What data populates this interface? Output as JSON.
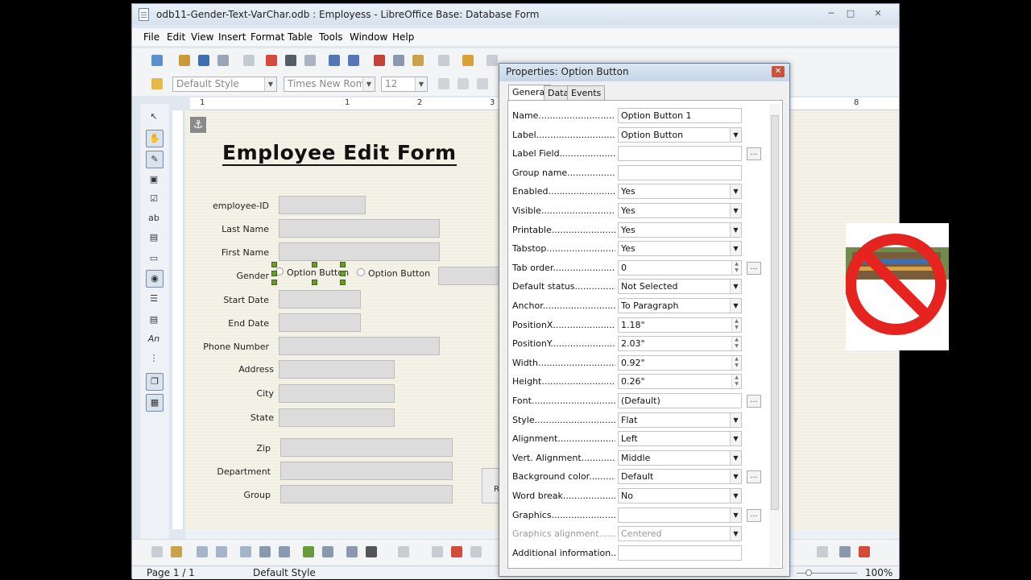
{
  "window": {
    "title": "odb11-Gender-Text-VarChar.odb : Employess - LibreOffice Base: Database Form"
  },
  "menu": [
    "File",
    "Edit",
    "View",
    "Insert",
    "Format",
    "Table",
    "Tools",
    "Window",
    "Help"
  ],
  "format_toolbar": {
    "style": "Default Style",
    "font": "Times New Roman",
    "size": "12"
  },
  "ruler_numbers": [
    "1",
    "1",
    "2",
    "3",
    "8"
  ],
  "form": {
    "title": "Employee Edit Form",
    "labels": {
      "employee_id": "employee-ID",
      "last_name": "Last Name",
      "first_name": "First Name",
      "gender": "Gender",
      "start_date": "Start Date",
      "end_date": "End Date",
      "phone": "Phone Number",
      "address": "Address",
      "city": "City",
      "state": "State",
      "zip": "Zip",
      "department": "Department",
      "group": "Group"
    },
    "radio1": "Option Button",
    "radio2": "Option Button",
    "hidden_button_letter": "R"
  },
  "properties": {
    "title": "Properties: Option Button",
    "tabs": [
      "General",
      "Data",
      "Events"
    ],
    "rows": [
      {
        "label": "Name",
        "value": "Option Button 1",
        "kind": "text"
      },
      {
        "label": "Label",
        "value": "Option Button",
        "kind": "drop"
      },
      {
        "label": "Label Field",
        "value": "",
        "kind": "text",
        "dots": true
      },
      {
        "label": "Group name",
        "value": "",
        "kind": "text"
      },
      {
        "label": "Enabled",
        "value": "Yes",
        "kind": "drop"
      },
      {
        "label": "Visible",
        "value": "Yes",
        "kind": "drop"
      },
      {
        "label": "Printable",
        "value": "Yes",
        "kind": "drop"
      },
      {
        "label": "Tabstop",
        "value": "Yes",
        "kind": "drop"
      },
      {
        "label": "Tab order",
        "value": "0",
        "kind": "spin",
        "dots": true
      },
      {
        "label": "Default status",
        "value": "Not Selected",
        "kind": "drop"
      },
      {
        "label": "Anchor",
        "value": "To Paragraph",
        "kind": "drop"
      },
      {
        "label": "PositionX",
        "value": "1.18\"",
        "kind": "spin"
      },
      {
        "label": "PositionY",
        "value": "2.03\"",
        "kind": "spin"
      },
      {
        "label": "Width",
        "value": "0.92\"",
        "kind": "spin"
      },
      {
        "label": "Height",
        "value": "0.26\"",
        "kind": "spin"
      },
      {
        "label": "Font",
        "value": "(Default)",
        "kind": "text",
        "dots": true
      },
      {
        "label": "Style",
        "value": "Flat",
        "kind": "drop"
      },
      {
        "label": "Alignment",
        "value": "Left",
        "kind": "drop"
      },
      {
        "label": "Vert. Alignment",
        "value": "Middle",
        "kind": "drop"
      },
      {
        "label": "Background color",
        "value": "Default",
        "kind": "drop",
        "dots": true
      },
      {
        "label": "Word break",
        "value": "No",
        "kind": "drop"
      },
      {
        "label": "Graphics",
        "value": "",
        "kind": "drop",
        "dots": true
      },
      {
        "label": "Graphics alignment",
        "value": "Centered",
        "kind": "drop",
        "disabled": true
      },
      {
        "label": "Additional information",
        "value": "",
        "kind": "text"
      }
    ]
  },
  "status": {
    "page": "Page 1 / 1",
    "style": "Default Style",
    "zoom": "100%"
  }
}
